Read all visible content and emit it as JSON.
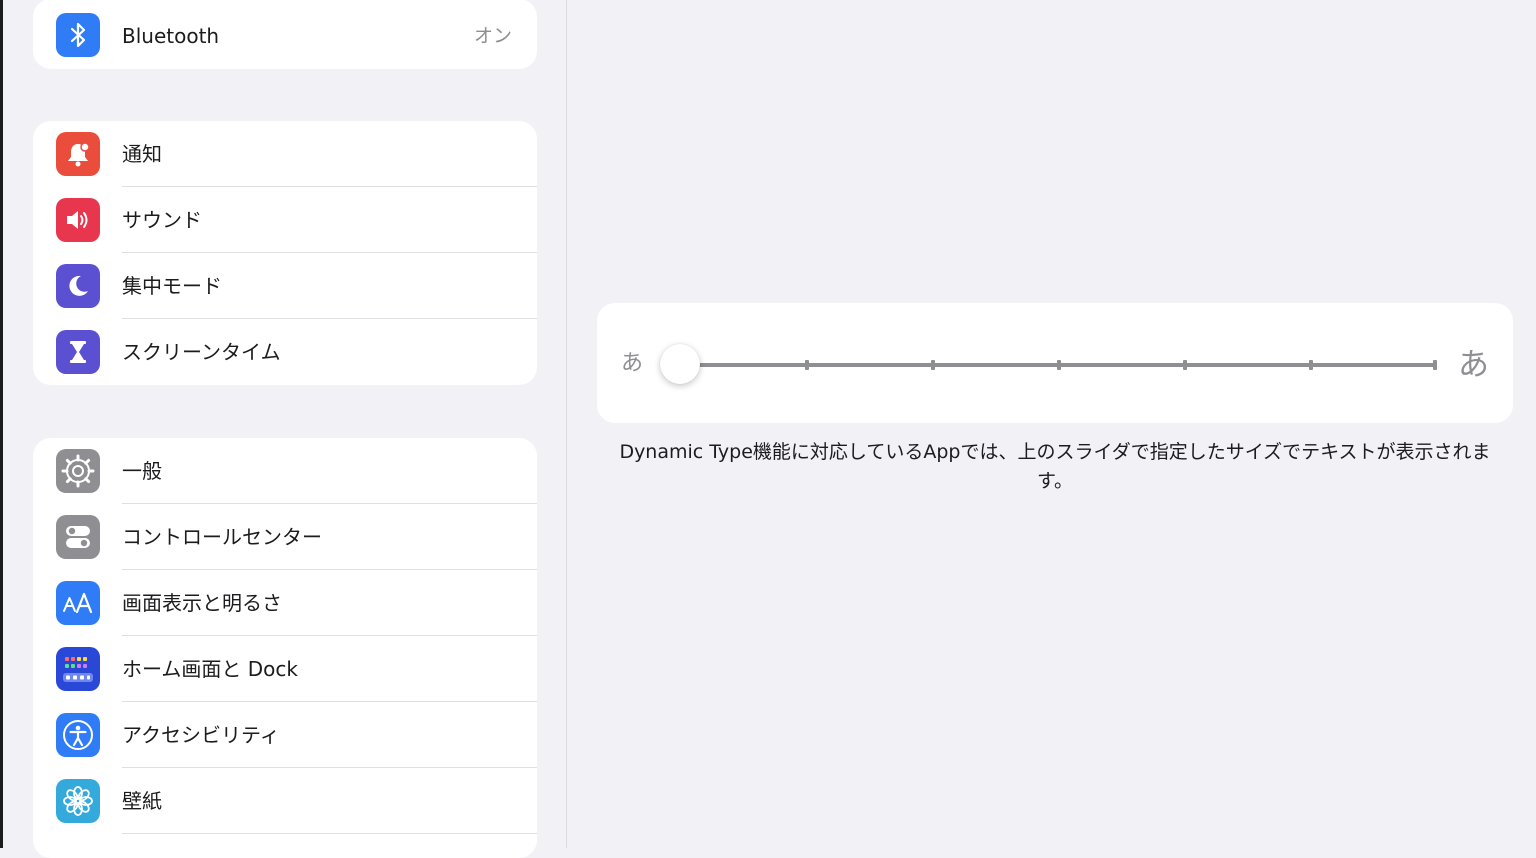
{
  "sidebar": {
    "group1": [
      {
        "label": "Bluetooth",
        "value": "オン",
        "icon": "bluetooth-icon",
        "color": "#2f7cf6"
      }
    ],
    "group2": [
      {
        "label": "通知",
        "icon": "notifications-bell-icon",
        "color": "#eb4d3d"
      },
      {
        "label": "サウンド",
        "icon": "speaker-icon",
        "color": "#e8364f"
      },
      {
        "label": "集中モード",
        "icon": "moon-icon",
        "color": "#5b4fd2"
      },
      {
        "label": "スクリーンタイム",
        "icon": "hourglass-icon",
        "color": "#5b4fd2"
      }
    ],
    "group3": [
      {
        "label": "一般",
        "icon": "gear-icon",
        "color": "#8e8e93"
      },
      {
        "label": "コントロールセンター",
        "icon": "toggles-icon",
        "color": "#8e8e93"
      },
      {
        "label": "画面表示と明るさ",
        "icon": "text-size-aa-icon",
        "color": "#2f7cf6"
      },
      {
        "label": "ホーム画面と Dock",
        "icon": "home-grid-icon",
        "color": "#2a48d8"
      },
      {
        "label": "アクセシビリティ",
        "icon": "accessibility-icon",
        "color": "#2f7cf6"
      },
      {
        "label": "壁紙",
        "icon": "flower-icon",
        "color": "#34aadc"
      }
    ]
  },
  "text_size": {
    "small_label": "あ",
    "large_label": "あ",
    "steps": 7,
    "selected_step": 1,
    "caption": "Dynamic Type機能に対応しているAppでは、上のスライダで指定したサイズでテキストが表示されます。"
  }
}
